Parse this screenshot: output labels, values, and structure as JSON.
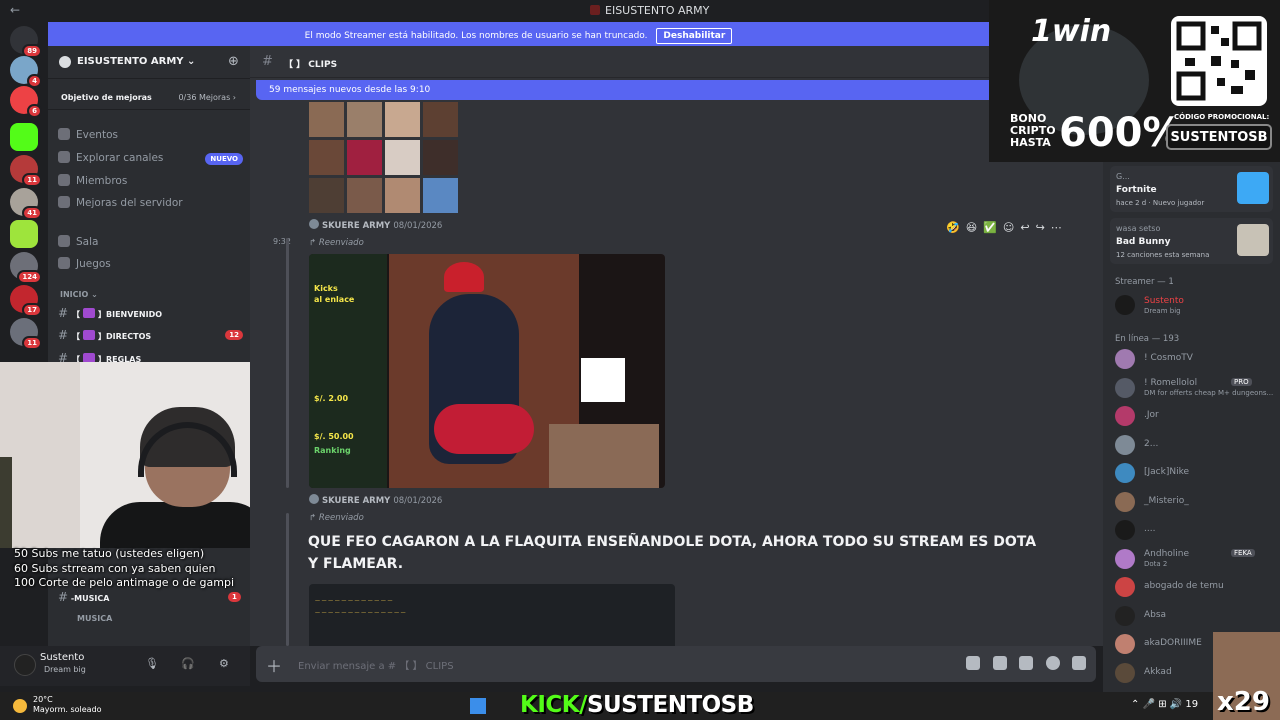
{
  "window": {
    "title": "EISUSTENTO ARMY"
  },
  "streamer_banner": {
    "text": "El modo Streamer está habilitado. Los nombres de usuario se han truncado.",
    "button": "Deshabilitar"
  },
  "server_badges": [
    "89",
    "4",
    "6",
    "11",
    "41",
    "124",
    "17",
    "11"
  ],
  "guild": {
    "name": "EISUSTENTO ARMY ⌄",
    "goal_label": "Objetivo de mejoras",
    "goal_value": "0/36 Mejoras ›"
  },
  "nav": [
    {
      "label": "Eventos"
    },
    {
      "label": "Explorar canales",
      "badge": "NUEVO"
    },
    {
      "label": "Miembros"
    },
    {
      "label": "Mejoras del servidor"
    },
    {
      "label": "Sala"
    },
    {
      "label": "Juegos"
    }
  ],
  "category": "INICIO ⌄",
  "channels": [
    {
      "name": "BIENVENIDO",
      "count": ""
    },
    {
      "name": "DIRECTOS",
      "count": "12"
    },
    {
      "name": "REGLAS",
      "count": ""
    }
  ],
  "channels_bottom": [
    {
      "name": "-MUSICA",
      "count": "1"
    },
    {
      "name": "MUSICA",
      "count": ""
    }
  ],
  "overlay_subs": [
    "50 Subs me tatuo (ustedes eligen)",
    "60 Subs strream con ya saben quien",
    "100 Corte de pelo antimage o de gampi"
  ],
  "user": {
    "name": "Sustento",
    "status": "Dream big"
  },
  "chat": {
    "channel": "CLIPS",
    "new_messages": "59 mensajes nuevos desde las 9:10",
    "messages": [
      {
        "author": "SKUERE ARMY",
        "date": "08/01/2026"
      },
      {
        "time": "9:32",
        "forwarded": "Reenviado"
      },
      {
        "author": "SKUERE ARMY",
        "date": "08/01/2026"
      },
      {
        "forwarded": "Reenviado"
      }
    ],
    "big_text": "QUE FEO CAGARON A LA FLAQUITA ENSEÑANDOLE DOTA, AHORA TODO SU STREAM ES DOTA Y FLAMEAR.",
    "stream_texts": [
      "Kicks",
      "al enlace",
      "Ranking",
      "$/. 2.00",
      "$/. 50.00"
    ],
    "composer_placeholder": "Enviar mensaje a # 【 】 CLIPS"
  },
  "activities": [
    {
      "game": "G...",
      "title": "Fortnite",
      "sub": "hace 2 d · Nuevo jugador",
      "color": "#3da9f5"
    },
    {
      "game": "wasa setso",
      "title": "Bad Bunny",
      "sub": "12 canciones esta semana",
      "color": "#c8c2b6"
    }
  ],
  "members": {
    "streamer_header": "Streamer — 1",
    "streamer": {
      "name": "Sustento",
      "sub": "Dream big"
    },
    "online_header": "En línea — 193",
    "list": [
      {
        "name": "! CosmoTV",
        "sub": "",
        "tag": ""
      },
      {
        "name": "! Romellolol",
        "sub": "DM for offerts cheap M+ dungeons...",
        "tag": "PRO"
      },
      {
        "name": ".Jor",
        "sub": "",
        "tag": ""
      },
      {
        "name": "2...",
        "sub": "",
        "tag": ""
      },
      {
        "name": "[Jack]Nike",
        "sub": "",
        "tag": ""
      },
      {
        "name": "_Misterio_",
        "sub": "",
        "tag": ""
      },
      {
        "name": "....",
        "sub": "",
        "tag": ""
      },
      {
        "name": "Andholine",
        "sub": "Dota 2",
        "tag": "FEKA"
      },
      {
        "name": "abogado de temu",
        "sub": "",
        "tag": ""
      },
      {
        "name": "Absa",
        "sub": "",
        "tag": ""
      },
      {
        "name": "akaDORIIIME",
        "sub": "",
        "tag": "FEKA"
      },
      {
        "name": "Akkad",
        "sub": "",
        "tag": ""
      }
    ]
  },
  "ad": {
    "brand": "1win",
    "bono": "BONO\nCRIPTO\nHASTA",
    "percent": "600%",
    "code_label": "CÓDIGO PROMOCIONAL:",
    "code": "SUSTENTOSB"
  },
  "taskbar": {
    "temp": "20°C",
    "weather": "Mayorm. soleado",
    "kick_prefix": "KICK/",
    "kick_name": "SUSTENTOSB",
    "time": "19"
  },
  "sticker_text": "x29"
}
